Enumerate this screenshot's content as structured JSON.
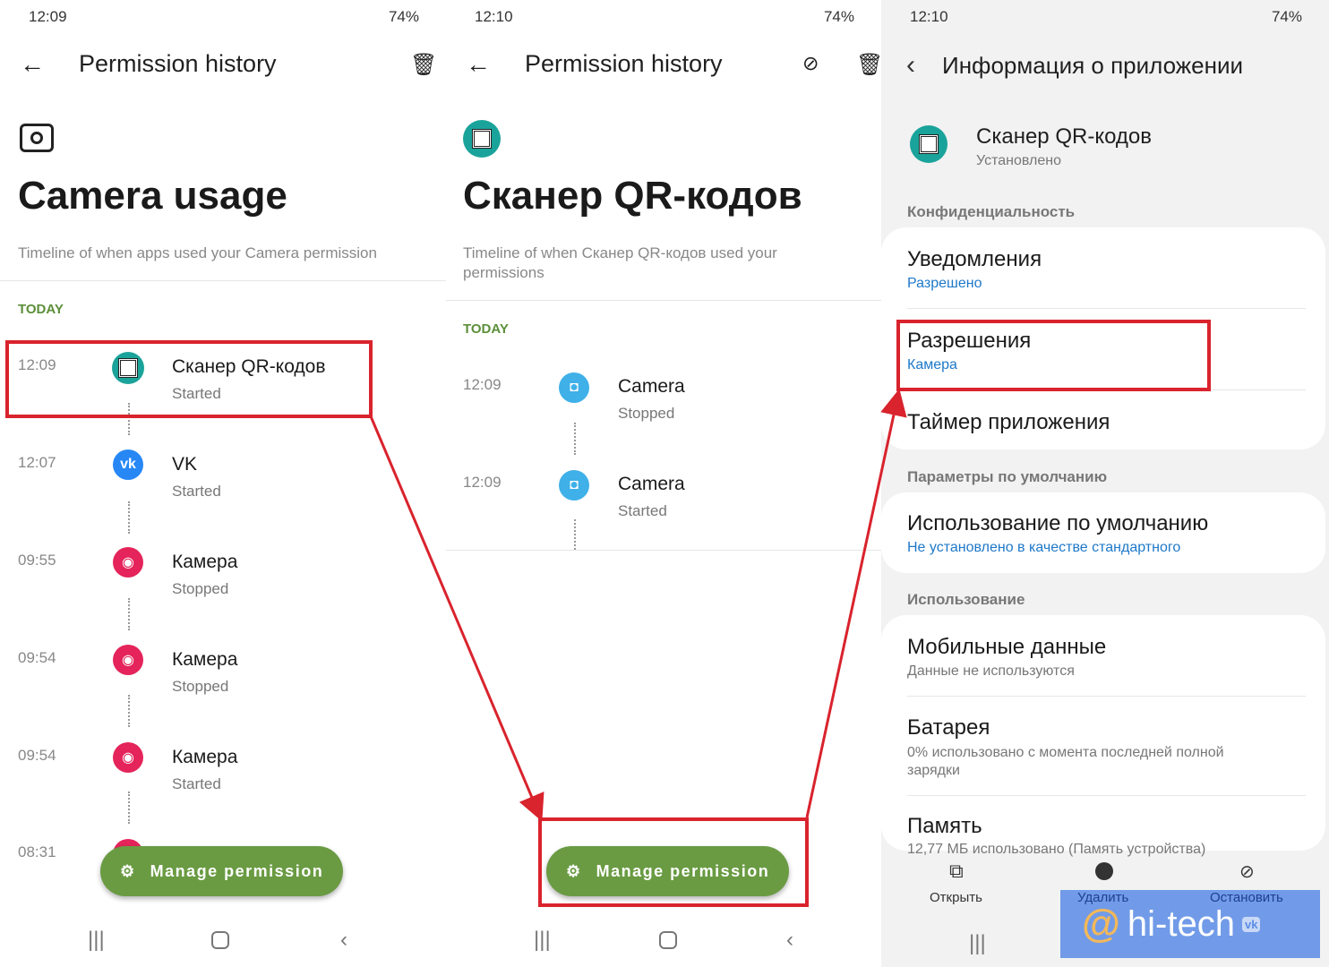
{
  "panel1": {
    "status_time": "12:09",
    "battery": "74%",
    "title": "Permission history",
    "heading": "Camera usage",
    "subtitle": "Timeline of when apps used your Camera permission",
    "section": "TODAY",
    "items": [
      {
        "time": "12:09",
        "app": "Сканер QR-кодов",
        "status": "Started",
        "icon": "qr-icon"
      },
      {
        "time": "12:07",
        "app": "VK",
        "status": "Started",
        "icon": "vk-icon"
      },
      {
        "time": "09:55",
        "app": "Камера",
        "status": "Stopped",
        "icon": "camera-app-icon"
      },
      {
        "time": "09:54",
        "app": "Камера",
        "status": "Stopped",
        "icon": "camera-app-icon"
      },
      {
        "time": "09:54",
        "app": "Камера",
        "status": "Started",
        "icon": "camera-app-icon"
      },
      {
        "time": "08:31",
        "icon": "camera-app-icon"
      }
    ],
    "fab": "Manage permission"
  },
  "panel2": {
    "status_time": "12:10",
    "battery": "74%",
    "title": "Permission history",
    "heading": "Сканер QR-кодов",
    "subtitle": "Timeline of when Сканер QR-кодов used your permissions",
    "section": "TODAY",
    "items": [
      {
        "time": "12:09",
        "app": "Camera",
        "status": "Stopped"
      },
      {
        "time": "12:09",
        "app": "Camera",
        "status": "Started"
      }
    ],
    "fab": "Manage permission"
  },
  "panel3": {
    "status_time": "12:10",
    "battery": "74%",
    "title": "Информация о приложении",
    "app_name": "Сканер QR-кодов",
    "app_status": "Установлено",
    "sec_privacy": "Конфиденциальность",
    "notifications": "Уведомления",
    "notifications_val": "Разрешено",
    "permissions": "Разрешения",
    "permissions_val": "Камера",
    "timer": "Таймер приложения",
    "sec_defaults": "Параметры по умолчанию",
    "default_use": "Использование по умолчанию",
    "default_use_val": "Не установлено в качестве стандартного",
    "sec_usage": "Использование",
    "mobile_data": "Мобильные данные",
    "mobile_data_val": "Данные не используются",
    "battery_item": "Батарея",
    "battery_val": "0% использовано с момента последней полной зарядки",
    "storage": "Память",
    "storage_val": "12,77 МБ использовано (Память устройства)",
    "actions": {
      "open": "Открыть",
      "uninstall": "Удалить",
      "stop": "Остановить"
    },
    "watermark": "hi-tech"
  },
  "colors": {
    "accent_green": "#6a9b43",
    "highlight_red": "#d9232d",
    "link_blue": "#1e78c8"
  }
}
